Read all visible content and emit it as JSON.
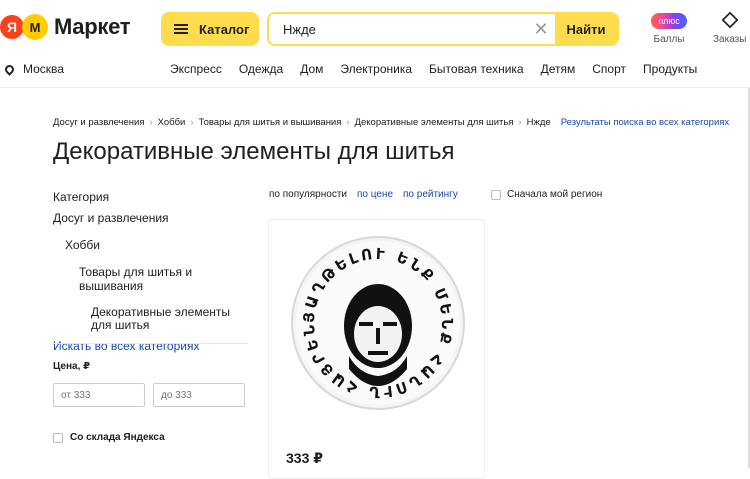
{
  "header": {
    "logo_ya": "Я",
    "logo_text": "Маркет",
    "catalog_label": "Каталог",
    "search_value": "Нжде",
    "find_label": "Найти",
    "plus_badge": "плюс",
    "points_label": "Баллы",
    "orders_label": "Заказы"
  },
  "location": "Москва",
  "nav": [
    "Экспресс",
    "Одежда",
    "Дом",
    "Электроника",
    "Бытовая техника",
    "Детям",
    "Спорт",
    "Продукты"
  ],
  "breadcrumbs": [
    "Досуг и развлечения",
    "Хобби",
    "Товары для шитья и вышивания",
    "Декоративные элементы для шитья",
    "Нжде"
  ],
  "breadcrumb_all": "Результаты поиска во всех категориях",
  "page_title": "Декоративные элементы для шитья",
  "sidebar": {
    "heading": "Категория",
    "items": [
      "Досуг и развлечения",
      "Хобби",
      "Товары для шитья и вышивания",
      "Декоративные элементы для шитья"
    ],
    "search_all": "Искать во всех категориях",
    "price_label": "Цена, ₽",
    "price_from": "от 333",
    "price_to": "до 333",
    "stock_label": "Со склада Яндекса"
  },
  "sort": {
    "popularity": "по популярности",
    "price": "по цене",
    "rating": "по рейтингу",
    "region": "Сначала мой регион"
  },
  "product": {
    "price": "333 ₽",
    "patch_text": "ՅԱՂԹԵԼՈՒ ԵՆՔ ՄԵՆՔ ՀԱՆՈՒՆ ՀԱՅՐԵՆԻՔԻ"
  },
  "colors": {
    "accent": "#ffdc4d",
    "link": "#1a49a8",
    "brand_red": "#fc3f1d"
  }
}
